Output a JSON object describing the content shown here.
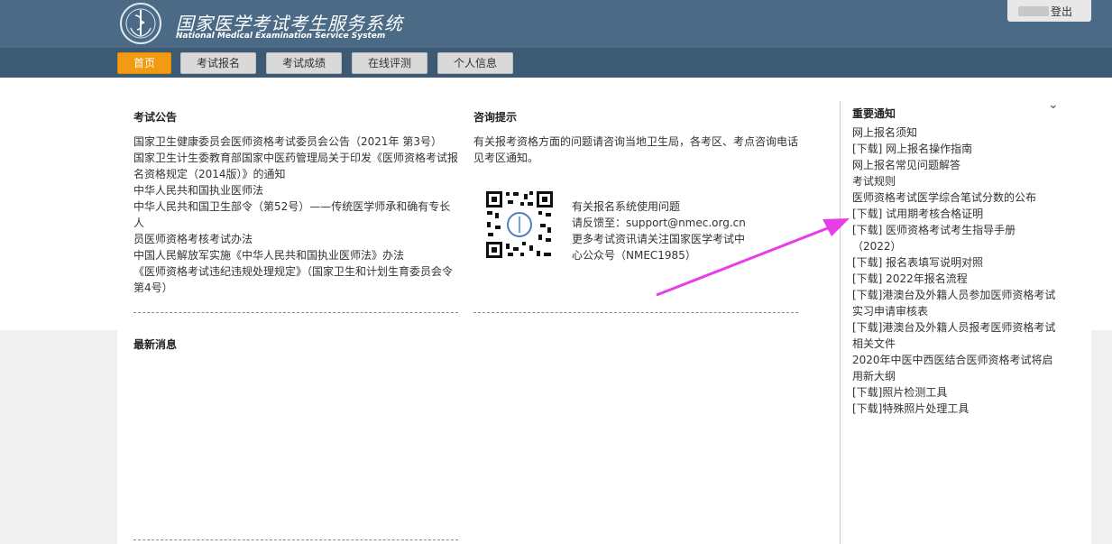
{
  "header": {
    "title": "国家医学考试考生服务系统",
    "subtitle": "National Medical Examination Service System",
    "logout": "登出"
  },
  "nav": [
    {
      "label": "首页",
      "active": true
    },
    {
      "label": "考试报名",
      "active": false
    },
    {
      "label": "考试成绩",
      "active": false
    },
    {
      "label": "在线评测",
      "active": false
    },
    {
      "label": "个人信息",
      "active": false
    }
  ],
  "announcements": {
    "title": "考试公告",
    "items": [
      "国家卫生健康委员会医师资格考试委员会公告（2021年 第3号）",
      "国家卫生计生委教育部国家中医药管理局关于印发《医师资格考试报",
      "名资格规定（2014版）》的通知",
      "中华人民共和国执业医师法",
      "中华人民共和国卫生部令（第52号）——传统医学师承和确有专长人",
      "员医师资格考核考试办法",
      "中国人民解放军实施《中华人民共和国执业医师法》办法",
      "《医师资格考试违纪违规处理规定》（国家卫生和计划生育委员会令",
      "第4号）"
    ]
  },
  "consult": {
    "title": "咨询提示",
    "text_lines": [
      "有关报考资格方面的问题请咨询当地卫生局，各考区、考点咨询电话",
      "见考区通知。"
    ],
    "qr_lines": [
      "有关报名系统使用问题",
      "请反馈至：support@nmec.org.cn",
      "更多考试资讯请关注国家医学考试中",
      "心公众号（NMEC1985）"
    ]
  },
  "news": {
    "title": "最新消息"
  },
  "important": {
    "title": "重要通知",
    "items": [
      "网上报名须知",
      "[下载] 网上报名操作指南",
      "网上报名常见问题解答",
      "考试规则",
      "医师资格考试医学综合笔试分数的公布",
      "[下载] 试用期考核合格证明",
      "[下载] 医师资格考试考生指导手册",
      "（2022）",
      "[下载] 报名表填写说明对照",
      "[下载] 2022年报名流程",
      "[下载]港澳台及外籍人员参加医师资格考试",
      "实习申请审核表",
      "[下载]港澳台及外籍人员报考医师资格考试",
      "相关文件",
      "2020年中医中西医结合医师资格考试将启",
      "用新大纲",
      "[下载]照片检测工具",
      "[下载]特殊照片处理工具"
    ]
  },
  "colors": {
    "header_bg": "#4a6a85",
    "nav_bg": "#3c5a73",
    "active_tab": "#f29b12",
    "arrow": "#e83ee8"
  }
}
